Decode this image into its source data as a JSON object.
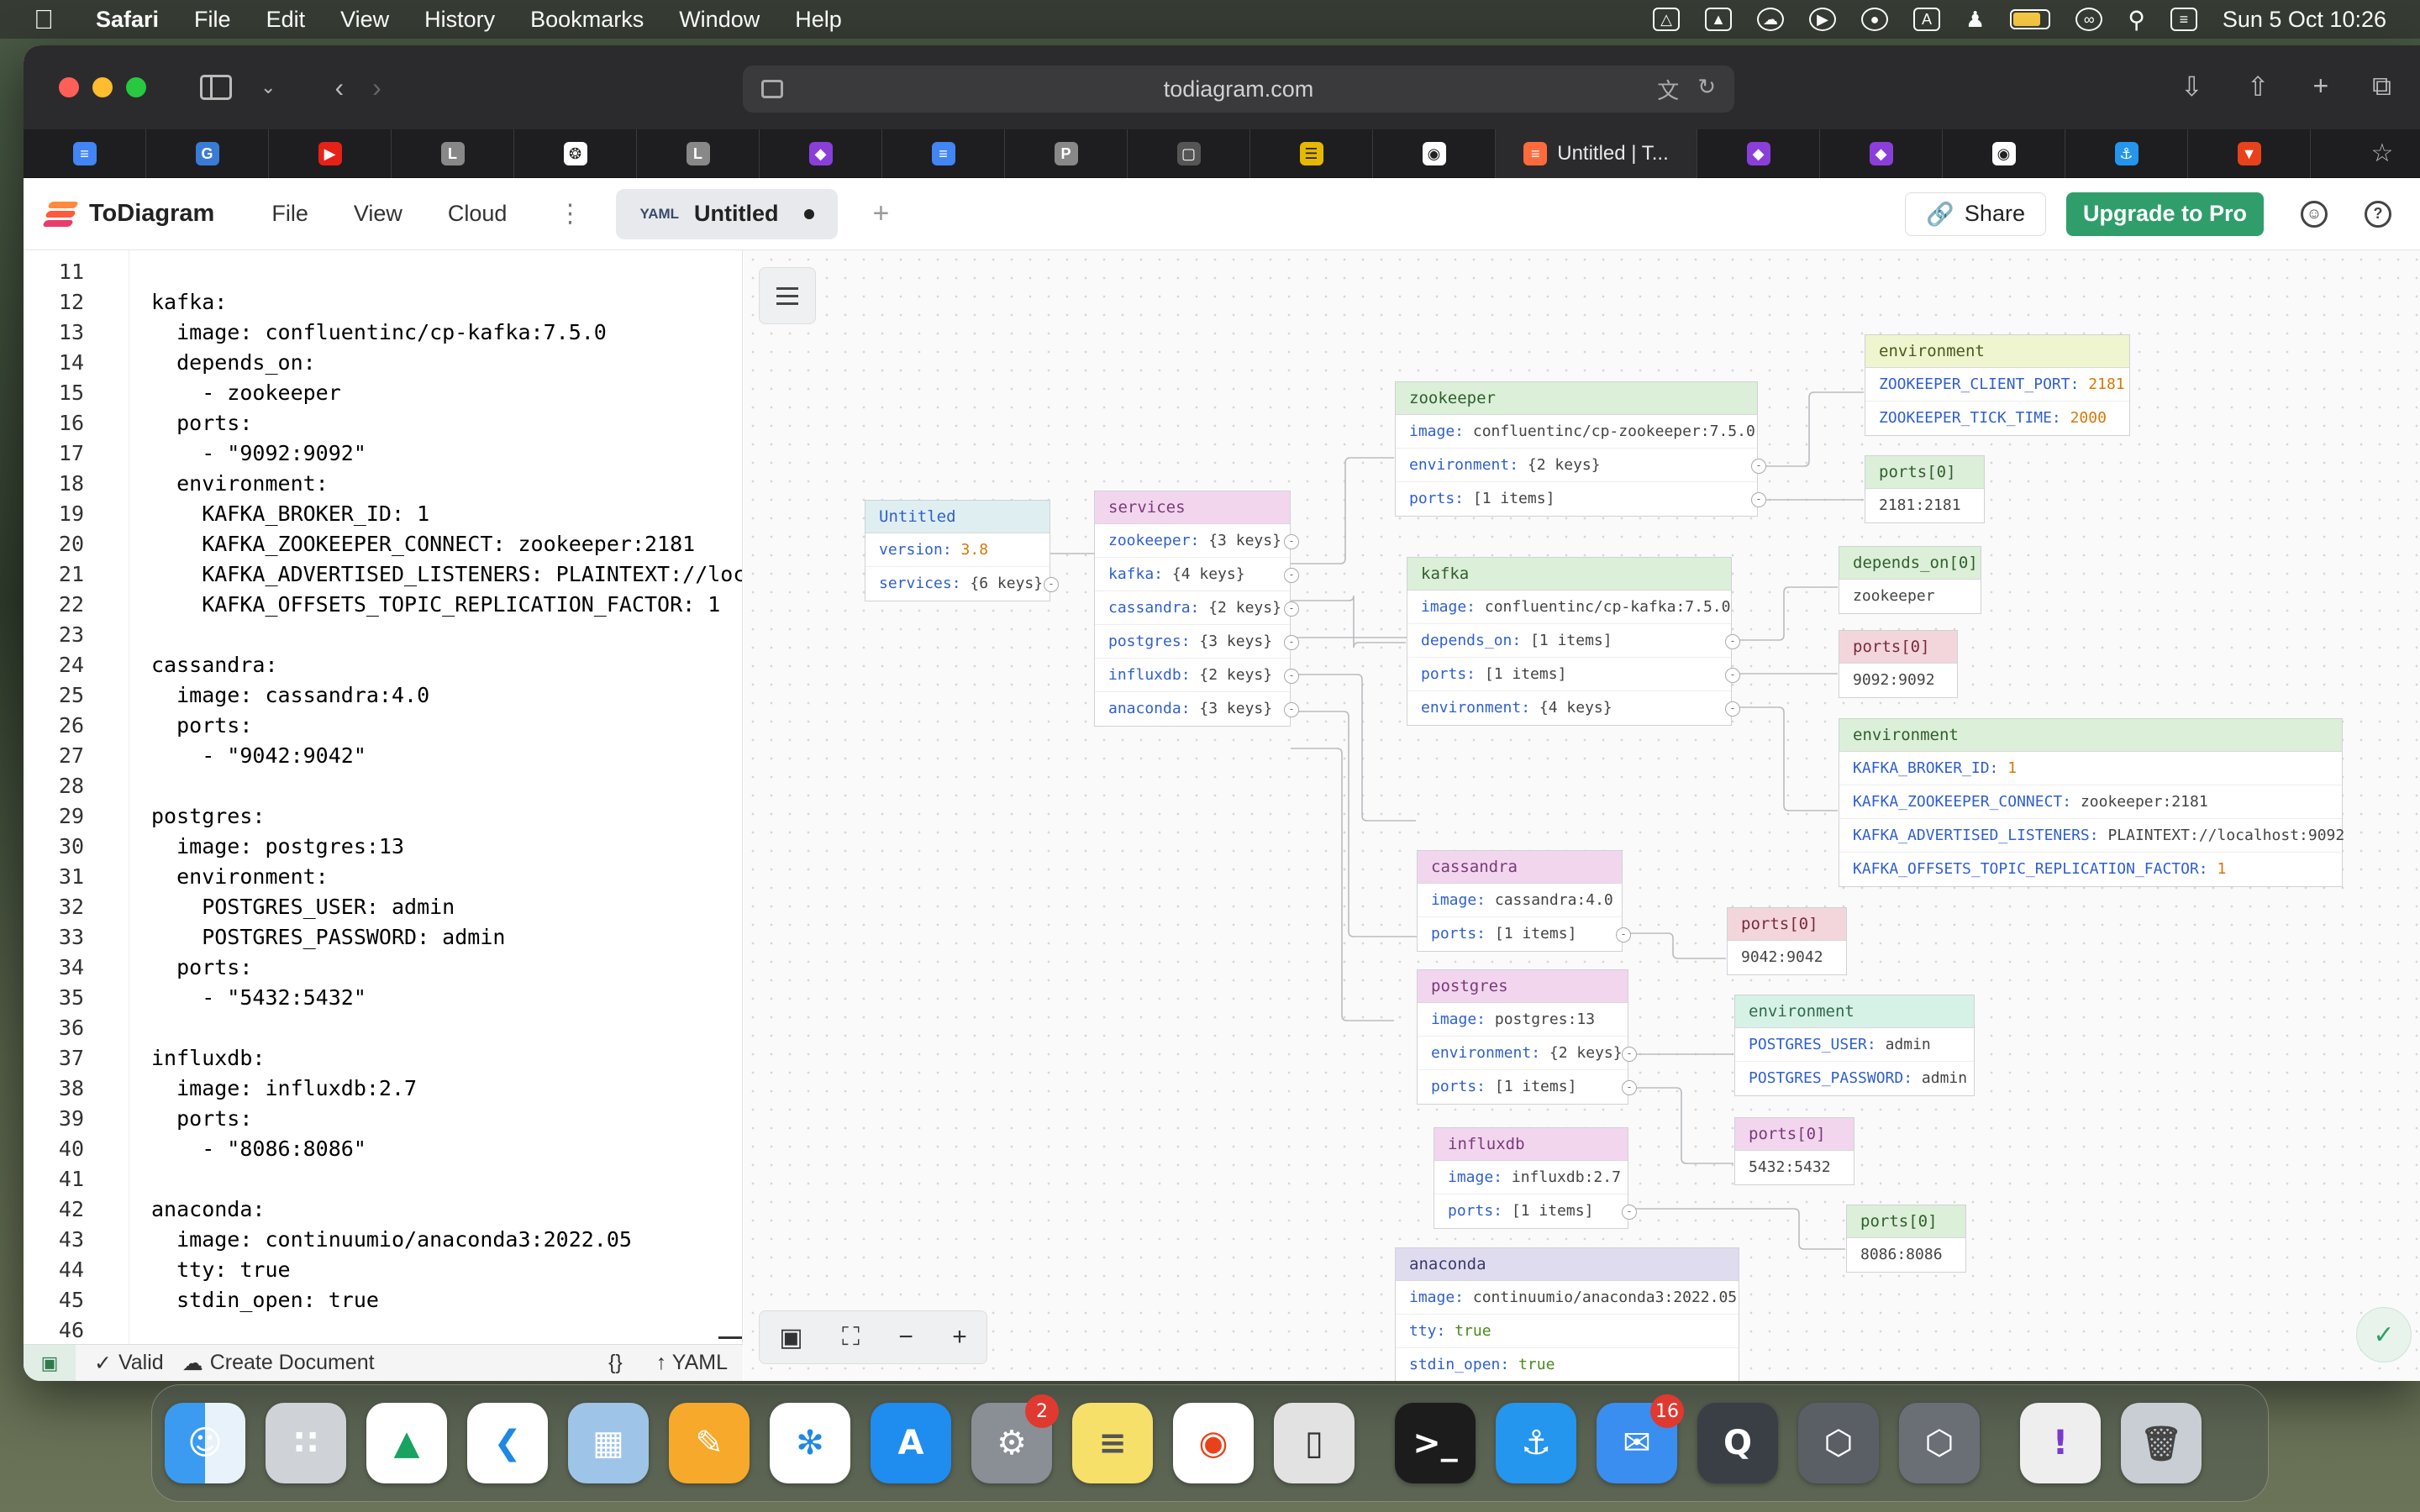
{
  "menubar": {
    "app": "Safari",
    "items": [
      "File",
      "Edit",
      "View",
      "History",
      "Bookmarks",
      "Window",
      "Help"
    ],
    "clock": "Sun 5 Oct  10:26",
    "input_source": "A"
  },
  "browser": {
    "url": "todiagram.com",
    "active_tab_title": "Untitled | T..."
  },
  "app": {
    "name": "ToDiagram",
    "menu": [
      "File",
      "View",
      "Cloud"
    ],
    "doc_format": "YAML",
    "doc_name": "Untitled",
    "share_label": "Share",
    "upgrade_label": "Upgrade to Pro"
  },
  "editor": {
    "lines": [
      {
        "n": "11",
        "t": ""
      },
      {
        "n": "12",
        "t": "kafka:"
      },
      {
        "n": "13",
        "t": "  image: confluentinc/cp-kafka:7.5.0"
      },
      {
        "n": "14",
        "t": "  depends_on:"
      },
      {
        "n": "15",
        "t": "    - zookeeper"
      },
      {
        "n": "16",
        "t": "  ports:"
      },
      {
        "n": "17",
        "t": "    - \"9092:9092\""
      },
      {
        "n": "18",
        "t": "  environment:"
      },
      {
        "n": "19",
        "t": "    KAFKA_BROKER_ID: 1"
      },
      {
        "n": "20",
        "t": "    KAFKA_ZOOKEEPER_CONNECT: zookeeper:2181"
      },
      {
        "n": "21",
        "t": "    KAFKA_ADVERTISED_LISTENERS: PLAINTEXT://local"
      },
      {
        "n": "22",
        "t": "    KAFKA_OFFSETS_TOPIC_REPLICATION_FACTOR: 1"
      },
      {
        "n": "23",
        "t": ""
      },
      {
        "n": "24",
        "t": "cassandra:"
      },
      {
        "n": "25",
        "t": "  image: cassandra:4.0"
      },
      {
        "n": "26",
        "t": "  ports:"
      },
      {
        "n": "27",
        "t": "    - \"9042:9042\""
      },
      {
        "n": "28",
        "t": ""
      },
      {
        "n": "29",
        "t": "postgres:"
      },
      {
        "n": "30",
        "t": "  image: postgres:13"
      },
      {
        "n": "31",
        "t": "  environment:"
      },
      {
        "n": "32",
        "t": "    POSTGRES_USER: admin"
      },
      {
        "n": "33",
        "t": "    POSTGRES_PASSWORD: admin"
      },
      {
        "n": "34",
        "t": "  ports:"
      },
      {
        "n": "35",
        "t": "    - \"5432:5432\""
      },
      {
        "n": "36",
        "t": ""
      },
      {
        "n": "37",
        "t": "influxdb:"
      },
      {
        "n": "38",
        "t": "  image: influxdb:2.7"
      },
      {
        "n": "39",
        "t": "  ports:"
      },
      {
        "n": "40",
        "t": "    - \"8086:8086\""
      },
      {
        "n": "41",
        "t": ""
      },
      {
        "n": "42",
        "t": "anaconda:"
      },
      {
        "n": "43",
        "t": "  image: continuumio/anaconda3:2022.05"
      },
      {
        "n": "44",
        "t": "  tty: true"
      },
      {
        "n": "45",
        "t": "  stdin_open: true"
      },
      {
        "n": "46",
        "t": ""
      }
    ]
  },
  "statusbar": {
    "valid": "Valid",
    "create": "Create Document",
    "braces": "{}",
    "format": "YAML"
  },
  "nodes": {
    "untitled": {
      "title": "Untitled",
      "rows": [
        [
          "version:",
          "3.8",
          "num"
        ],
        [
          "services:",
          "{6 keys}",
          "obj"
        ]
      ]
    },
    "services": {
      "title": "services",
      "rows": [
        [
          "zookeeper:",
          "{3 keys}",
          "obj"
        ],
        [
          "kafka:",
          "{4 keys}",
          "obj"
        ],
        [
          "cassandra:",
          "{2 keys}",
          "obj"
        ],
        [
          "postgres:",
          "{3 keys}",
          "obj"
        ],
        [
          "influxdb:",
          "{2 keys}",
          "obj"
        ],
        [
          "anaconda:",
          "{3 keys}",
          "obj"
        ]
      ]
    },
    "zookeeper": {
      "title": "zookeeper",
      "rows": [
        [
          "image:",
          "confluentinc/cp-zookeeper:7.5.0",
          "str"
        ],
        [
          "environment:",
          "{2 keys}",
          "obj"
        ],
        [
          "ports:",
          "[1 items]",
          "obj"
        ]
      ]
    },
    "zk_env": {
      "title": "environment",
      "rows": [
        [
          "ZOOKEEPER_CLIENT_PORT:",
          "2181",
          "num"
        ],
        [
          "ZOOKEEPER_TICK_TIME:",
          "2000",
          "num"
        ]
      ]
    },
    "zk_ports": {
      "title": "ports[0]",
      "rows": [
        [
          "",
          "2181:2181",
          "str"
        ]
      ]
    },
    "kafka": {
      "title": "kafka",
      "rows": [
        [
          "image:",
          "confluentinc/cp-kafka:7.5.0",
          "str"
        ],
        [
          "depends_on:",
          "[1 items]",
          "obj"
        ],
        [
          "ports:",
          "[1 items]",
          "obj"
        ],
        [
          "environment:",
          "{4 keys}",
          "obj"
        ]
      ]
    },
    "kafka_dep": {
      "title": "depends_on[0]",
      "rows": [
        [
          "",
          "zookeeper",
          "str"
        ]
      ]
    },
    "kafka_ports": {
      "title": "ports[0]",
      "rows": [
        [
          "",
          "9092:9092",
          "str"
        ]
      ]
    },
    "kafka_env": {
      "title": "environment",
      "rows": [
        [
          "KAFKA_BROKER_ID:",
          "1",
          "num"
        ],
        [
          "KAFKA_ZOOKEEPER_CONNECT:",
          "zookeeper:2181",
          "str"
        ],
        [
          "KAFKA_ADVERTISED_LISTENERS:",
          "PLAINTEXT://localhost:9092",
          "str"
        ],
        [
          "KAFKA_OFFSETS_TOPIC_REPLICATION_FACTOR:",
          "1",
          "num"
        ]
      ]
    },
    "cassandra": {
      "title": "cassandra",
      "rows": [
        [
          "image:",
          "cassandra:4.0",
          "str"
        ],
        [
          "ports:",
          "[1 items]",
          "obj"
        ]
      ]
    },
    "cassandra_ports": {
      "title": "ports[0]",
      "rows": [
        [
          "",
          "9042:9042",
          "str"
        ]
      ]
    },
    "postgres": {
      "title": "postgres",
      "rows": [
        [
          "image:",
          "postgres:13",
          "str"
        ],
        [
          "environment:",
          "{2 keys}",
          "obj"
        ],
        [
          "ports:",
          "[1 items]",
          "obj"
        ]
      ]
    },
    "pg_env": {
      "title": "environment",
      "rows": [
        [
          "POSTGRES_USER:",
          "admin",
          "str"
        ],
        [
          "POSTGRES_PASSWORD:",
          "admin",
          "str"
        ]
      ]
    },
    "pg_ports": {
      "title": "ports[0]",
      "rows": [
        [
          "",
          "5432:5432",
          "str"
        ]
      ]
    },
    "influxdb": {
      "title": "influxdb",
      "rows": [
        [
          "image:",
          "influxdb:2.7",
          "str"
        ],
        [
          "ports:",
          "[1 items]",
          "obj"
        ]
      ]
    },
    "influx_ports": {
      "title": "ports[0]",
      "rows": [
        [
          "",
          "8086:8086",
          "str"
        ]
      ]
    },
    "anaconda": {
      "title": "anaconda",
      "rows": [
        [
          "image:",
          "continuumio/anaconda3:2022.05",
          "str"
        ],
        [
          "tty:",
          "true",
          "bool"
        ],
        [
          "stdin_open:",
          "true",
          "bool"
        ]
      ]
    }
  },
  "dock": {
    "badges": {
      "system_settings": "2",
      "mail": "16"
    }
  },
  "colors": {
    "accent": "#2f9e6a",
    "key": "#2f5fd1",
    "number": "#d97706",
    "boolean": "#4a8a1a"
  }
}
